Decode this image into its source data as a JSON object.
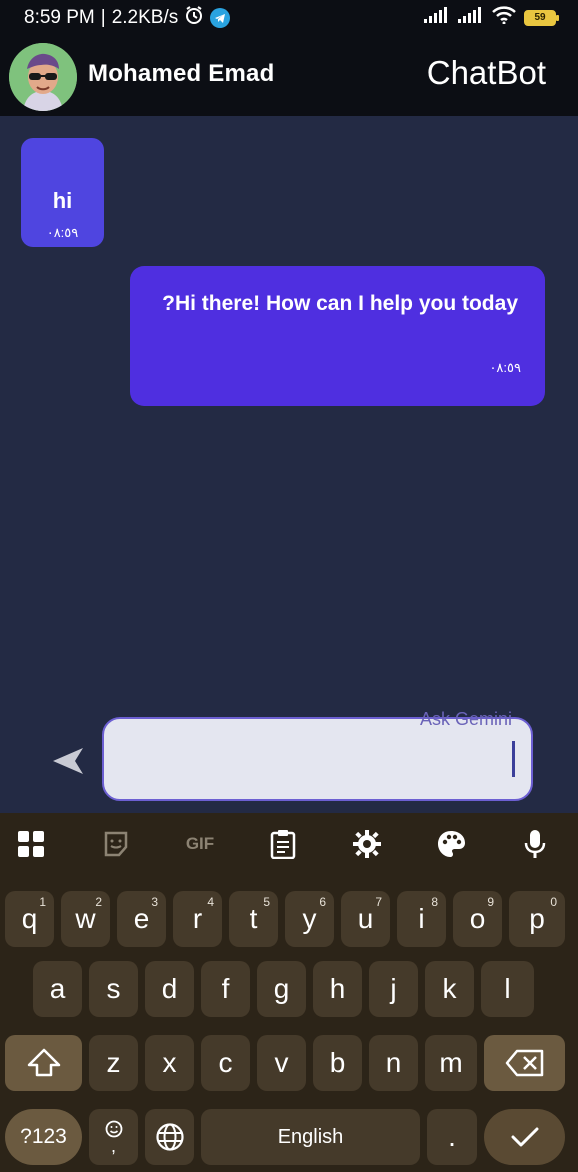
{
  "status_bar": {
    "time": "8:59 PM",
    "network_speed": "2.2KB/s",
    "battery_level": "59",
    "icons": [
      "alarm-icon",
      "telegram-icon",
      "signal-icon",
      "signal-icon",
      "wifi-icon",
      "battery-icon"
    ]
  },
  "header": {
    "username": "Mohamed Emad",
    "app_title": "ChatBot",
    "avatar": "avatar-icon"
  },
  "messages": [
    {
      "sender": "user",
      "text": "hi",
      "time": "٠٨:٥٩"
    },
    {
      "sender": "bot",
      "text": "?Hi there! How can I help you today",
      "time": "٠٨:٥٩"
    }
  ],
  "composer": {
    "label": "Ask Gemini",
    "value": "",
    "send_icon": "send-icon"
  },
  "keyboard": {
    "toolbar": [
      "apps-icon",
      "sticker-icon",
      "gif-icon",
      "clipboard-icon",
      "gear-icon",
      "palette-icon",
      "mic-icon"
    ],
    "gif_label": "GIF",
    "row1": [
      {
        "key": "q",
        "hint": "1"
      },
      {
        "key": "w",
        "hint": "2"
      },
      {
        "key": "e",
        "hint": "3"
      },
      {
        "key": "r",
        "hint": "4"
      },
      {
        "key": "t",
        "hint": "5"
      },
      {
        "key": "y",
        "hint": "6"
      },
      {
        "key": "u",
        "hint": "7"
      },
      {
        "key": "i",
        "hint": "8"
      },
      {
        "key": "o",
        "hint": "9"
      },
      {
        "key": "p",
        "hint": "0"
      }
    ],
    "row2": [
      "a",
      "s",
      "d",
      "f",
      "g",
      "h",
      "j",
      "k",
      "l"
    ],
    "row3": [
      "z",
      "x",
      "c",
      "v",
      "b",
      "n",
      "m"
    ],
    "symbols_key": "?123",
    "emoji_key_comma": ",",
    "space_label": "English",
    "period_key": "."
  },
  "colors": {
    "chat_bg": "#232a44",
    "user_bubble": "#4f45e0",
    "bot_bubble": "#4f2fe0",
    "keyboard_bg": "#2c2418",
    "key_bg": "#453a2a"
  }
}
